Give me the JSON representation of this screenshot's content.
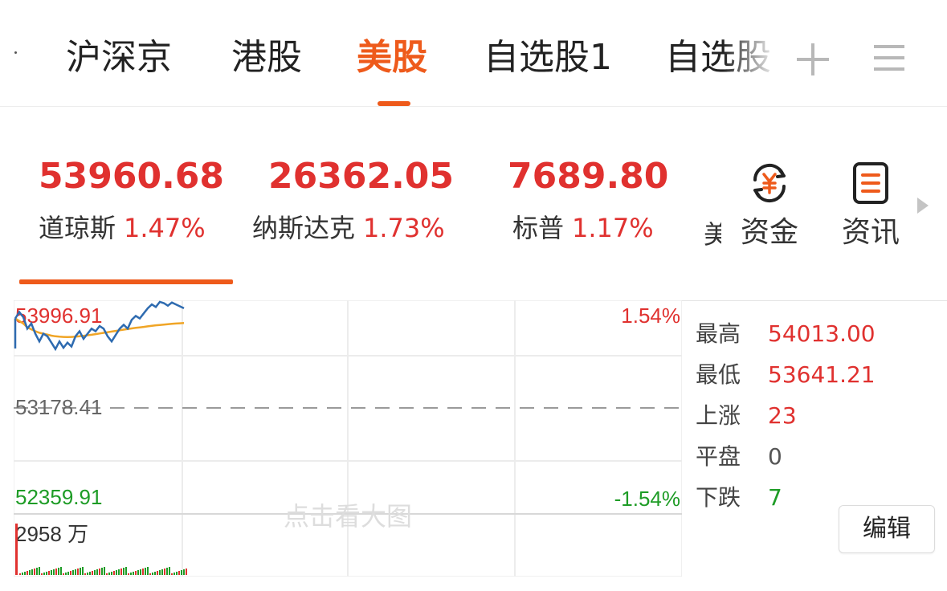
{
  "tabs": [
    {
      "label": "沪深京"
    },
    {
      "label": "港股"
    },
    {
      "label": "美股",
      "active": true
    },
    {
      "label": "自选股1"
    },
    {
      "label": "自选股"
    }
  ],
  "indices": [
    {
      "value": "53960.68",
      "name": "道琼斯",
      "change": "1.47%"
    },
    {
      "value": "26362.05",
      "name": "纳斯达克",
      "change": "1.73%"
    },
    {
      "value": "7689.80",
      "name": "标普",
      "change": "1.17%"
    }
  ],
  "tools": {
    "funds_label": "资金",
    "news_label": "资讯"
  },
  "chart": {
    "top_price": "53996.91",
    "mid_price": "53178.41",
    "low_price": "52359.91",
    "top_pct": "1.54%",
    "low_pct": "-1.54%",
    "volume_label": "2958 万",
    "watermark": "点击看大图"
  },
  "stats": [
    {
      "key": "最高",
      "value": "54013.00",
      "tone": "red"
    },
    {
      "key": "最低",
      "value": "53641.21",
      "tone": "red"
    },
    {
      "key": "上涨",
      "value": "23",
      "tone": "red"
    },
    {
      "key": "平盘",
      "value": "0",
      "tone": "gray"
    },
    {
      "key": "下跌",
      "value": "7",
      "tone": "green"
    }
  ],
  "edit_label": "编辑",
  "colors": {
    "accent": "#ee5a1b",
    "up": "#e0312f",
    "down": "#1e9c26",
    "price_line": "#2e6bb0",
    "avg_line": "#f0a526"
  },
  "chart_data": {
    "type": "line",
    "ylim": [
      52359.91,
      53996.91
    ],
    "reference": 53178.41,
    "series": [
      {
        "values": [
          53880,
          53930,
          53890,
          53800,
          53840,
          53760,
          53700,
          53760,
          53740,
          53690,
          53640,
          53700,
          53650,
          53690,
          53660,
          53740,
          53780,
          53720,
          53760,
          53800,
          53780,
          53820,
          53800,
          53740,
          53700,
          53750,
          53800,
          53830,
          53800,
          53870,
          53900,
          53880,
          53920,
          53960,
          53990,
          53970,
          54010,
          54000,
          53980,
          54005,
          53990,
          53975,
          53960
        ]
      },
      {
        "values": [
          53880,
          53860,
          53840,
          53810,
          53795,
          53780,
          53768,
          53760,
          53753,
          53745,
          53740,
          53737,
          53735,
          53734,
          53735,
          53737,
          53740,
          53744,
          53748,
          53752,
          53757,
          53762,
          53767,
          53772,
          53777,
          53782,
          53787,
          53792,
          53797,
          53802,
          53806,
          53810,
          53814,
          53818,
          53822,
          53826,
          53829,
          53832,
          53835,
          53838,
          53840,
          53842,
          53844
        ]
      }
    ]
  }
}
